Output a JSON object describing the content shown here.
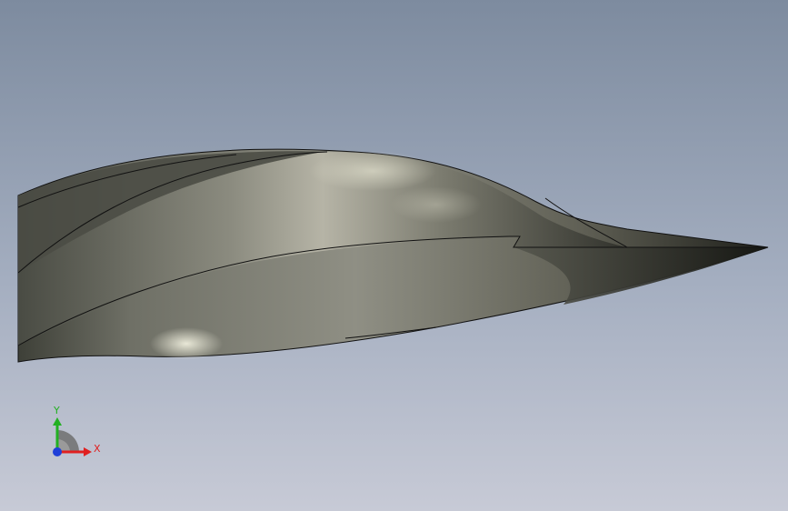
{
  "viewport": {
    "background_top": "#7d8b9f",
    "background_bottom": "#c7cad6",
    "model_color": "#8a8a80"
  },
  "triad": {
    "x_label": "X",
    "y_label": "Y",
    "x_color": "#e02020",
    "y_color": "#22b022",
    "z_color": "#1f3fd8"
  }
}
